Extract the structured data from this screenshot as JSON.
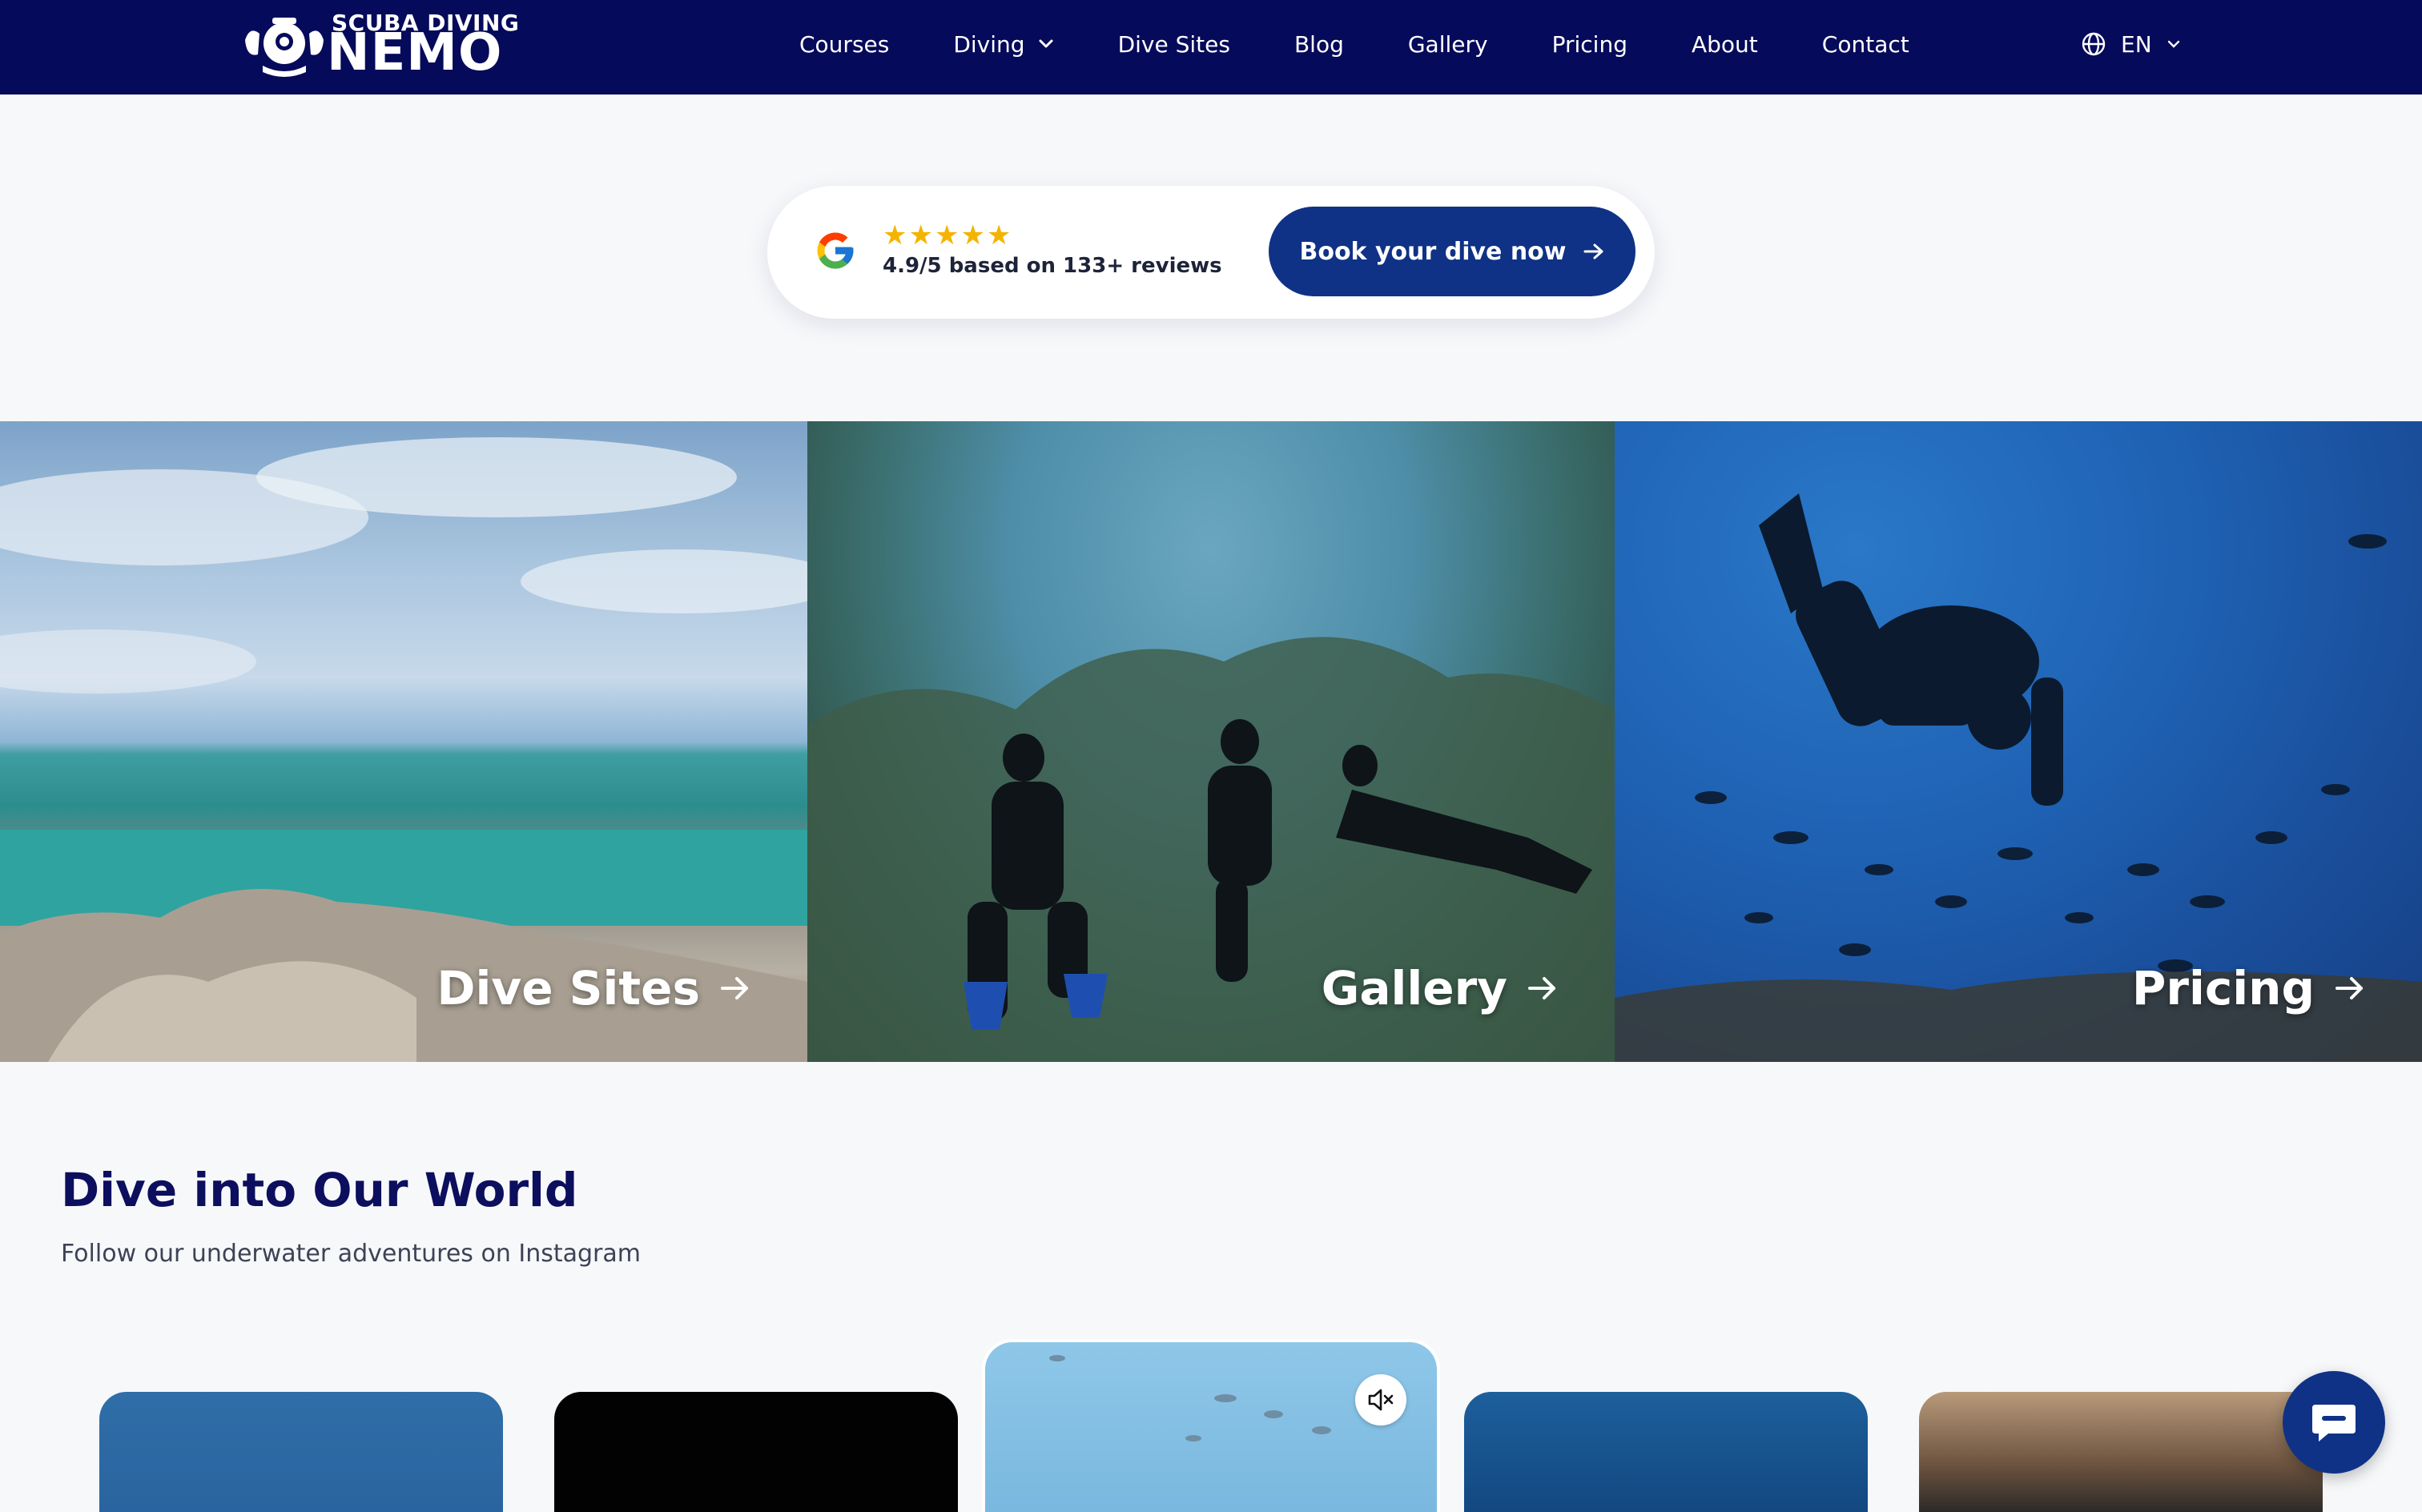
{
  "brand": {
    "top_text": "SCUBA DIVING",
    "main_text": "NEMO",
    "colors": {
      "nav_bg": "#060a5a",
      "accent": "#0f3286",
      "star": "#f5b301"
    }
  },
  "nav": {
    "items": [
      {
        "label": "Courses"
      },
      {
        "label": "Diving",
        "icon": "chevron-down-icon"
      },
      {
        "label": "Dive Sites"
      },
      {
        "label": "Blog"
      },
      {
        "label": "Gallery"
      },
      {
        "label": "Pricing"
      },
      {
        "label": "About"
      },
      {
        "label": "Contact"
      }
    ],
    "language": {
      "label": "EN",
      "icon": "globe-icon"
    }
  },
  "review": {
    "icon": "google-icon",
    "stars": "★★★★★",
    "rating_text": "4.9/5 based on 133+ reviews",
    "cta_label": "Book your dive now",
    "cta_icon": "arrow-right-icon"
  },
  "tiles": [
    {
      "label": "Dive Sites",
      "icon": "arrow-right-icon"
    },
    {
      "label": "Gallery",
      "icon": "arrow-right-icon"
    },
    {
      "label": "Pricing",
      "icon": "arrow-right-icon"
    }
  ],
  "instagram": {
    "title": "Dive into Our World",
    "subtitle": "Follow our underwater adventures on Instagram",
    "mute_icon": "mute-icon",
    "chat_icon": "chat-icon"
  }
}
